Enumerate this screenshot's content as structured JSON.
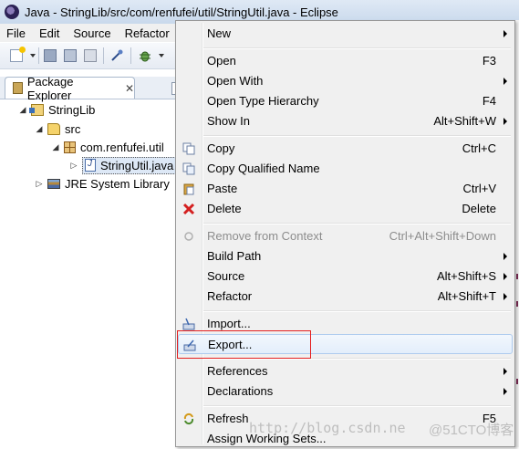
{
  "window": {
    "title": "Java - StringLib/src/com/renfufei/util/StringUtil.java - Eclipse"
  },
  "menubar": {
    "items": [
      "File",
      "Edit",
      "Source",
      "Refactor"
    ]
  },
  "toolbar": {
    "icons": [
      "new-wizard-icon",
      "save-icon",
      "save-all-icon",
      "print-icon",
      "pin-icon",
      "debug-icon"
    ]
  },
  "package_explorer": {
    "title": "Package Explorer",
    "close_glyph": "✕",
    "tree": [
      {
        "label": "StringLib",
        "icon": "java-project-icon",
        "twisty": "◢"
      },
      {
        "label": "src",
        "icon": "source-folder-icon",
        "twisty": "◢"
      },
      {
        "label": "com.renfufei.util",
        "icon": "package-icon",
        "twisty": "◢"
      },
      {
        "label": "StringUtil.java",
        "icon": "java-file-icon",
        "twisty": "▷"
      },
      {
        "label": "JRE System Library",
        "icon": "library-icon",
        "twisty": "▷"
      }
    ]
  },
  "context_menu": {
    "items": [
      {
        "label": "New",
        "shortcut": "",
        "submenu": true
      },
      {
        "label": "Open",
        "shortcut": "F3"
      },
      {
        "label": "Open With",
        "shortcut": "",
        "submenu": true
      },
      {
        "label": "Open Type Hierarchy",
        "shortcut": "F4"
      },
      {
        "label": "Show In",
        "shortcut": "Alt+Shift+W",
        "submenu": true
      },
      {
        "label": "Copy",
        "shortcut": "Ctrl+C",
        "icon": "copy-icon"
      },
      {
        "label": "Copy Qualified Name",
        "shortcut": "",
        "icon": "copy-qualified-name-icon"
      },
      {
        "label": "Paste",
        "shortcut": "Ctrl+V",
        "icon": "paste-icon"
      },
      {
        "label": "Delete",
        "shortcut": "Delete",
        "icon": "delete-icon"
      },
      {
        "label": "Remove from Context",
        "shortcut": "Ctrl+Alt+Shift+Down",
        "disabled": true,
        "icon": "remove-context-icon"
      },
      {
        "label": "Build Path",
        "shortcut": "",
        "submenu": true
      },
      {
        "label": "Source",
        "shortcut": "Alt+Shift+S",
        "submenu": true
      },
      {
        "label": "Refactor",
        "shortcut": "Alt+Shift+T",
        "submenu": true
      },
      {
        "label": "Import...",
        "shortcut": "",
        "icon": "import-icon"
      },
      {
        "label": "Export...",
        "shortcut": "",
        "icon": "export-icon",
        "highlighted": true
      },
      {
        "label": "References",
        "shortcut": "",
        "submenu": true
      },
      {
        "label": "Declarations",
        "shortcut": "",
        "submenu": true
      },
      {
        "label": "Refresh",
        "shortcut": "F5",
        "icon": "refresh-icon"
      },
      {
        "label": "Assign Working Sets...",
        "shortcut": ""
      }
    ]
  },
  "watermark": {
    "url": "http://blog.csdn.ne",
    "brand": "@51CTO博客"
  },
  "colors": {
    "highlight_border": "#aecbee",
    "annotation_red": "#e41f1f",
    "delete_red": "#d42020"
  }
}
